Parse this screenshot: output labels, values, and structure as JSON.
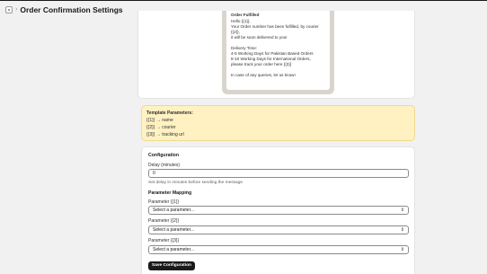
{
  "header": {
    "title": "Order Confirmation Settings",
    "app_icon": "app-icon",
    "separator": "›"
  },
  "preview": {
    "title": "Order Fulfilled",
    "lines_block1": [
      "Hello {{1}},",
      "Your Order number has been fulfilled, by courier {{2}},",
      "it will be soon delivered to you!"
    ],
    "lines_block2": [
      "Delivery Time:",
      "4-5 Working Days for Pakistan Based Orders",
      "8-10 Working Days for International Orders,",
      "please track your order here {{3}}"
    ],
    "lines_block3": [
      "In case of any queries, let us know!"
    ]
  },
  "template_params": {
    "title": "Template Parameters:",
    "items": [
      "{{1}} → name",
      "{{2}} → courier",
      "{{3}} → tracking url"
    ]
  },
  "config": {
    "title": "Configuration",
    "delay_label": "Delay (minutes)",
    "delay_value": "0",
    "delay_help": "Set delay in minutes before sending the message",
    "mapping_title": "Parameter Mapping",
    "params": [
      {
        "label": "Parameter {{1}}",
        "selected": "Select a parameter..."
      },
      {
        "label": "Parameter {{2}}",
        "selected": "Select a parameter..."
      },
      {
        "label": "Parameter {{3}}",
        "selected": "Select a parameter..."
      }
    ],
    "save_label": "Save Configuration"
  },
  "colors": {
    "banner_bg": "#fff1c2",
    "button_bg": "#1a1a1a",
    "page_bg": "#f1f1f1"
  }
}
